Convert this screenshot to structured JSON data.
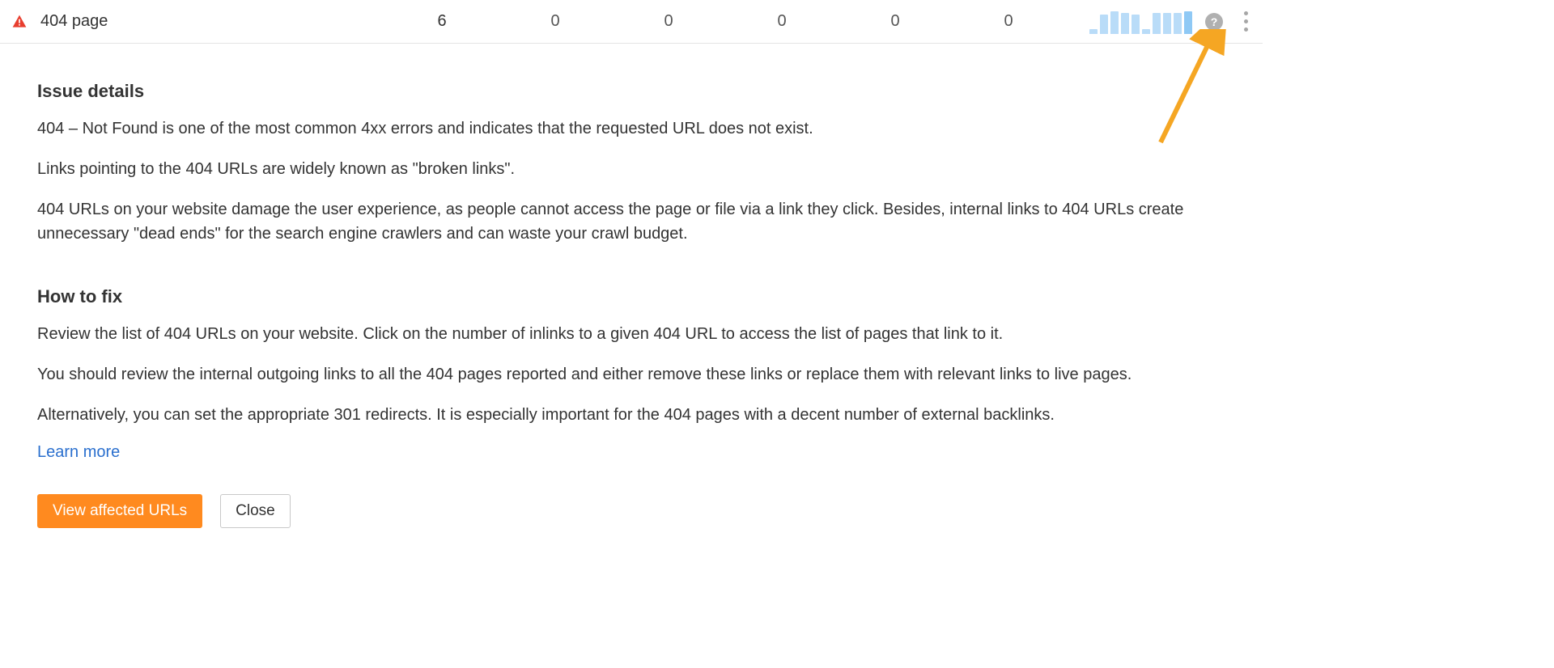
{
  "header": {
    "issue_name": "404 page",
    "counts": [
      "6",
      "0",
      "0",
      "0",
      "0",
      "0"
    ],
    "sparkline_heights": [
      6,
      24,
      28,
      26,
      24,
      6,
      26,
      26,
      26,
      28
    ],
    "help_symbol": "?"
  },
  "details": {
    "title": "Issue details",
    "paragraphs": [
      "404 – Not Found is one of the most common 4xx errors and indicates that the requested URL does not exist.",
      "Links pointing to the 404 URLs are widely known as \"broken links\".",
      "404 URLs on your website damage the user experience, as people cannot access the page or file via a link they click. Besides, internal links to 404 URLs create unnecessary \"dead ends\" for the search engine crawlers and can waste your crawl budget."
    ]
  },
  "fix": {
    "title": "How to fix",
    "paragraphs": [
      "Review the list of 404 URLs on your website. Click on the number of inlinks to a given 404 URL to access the list of pages that link to it.",
      "You should review the internal outgoing links to all the 404 pages reported and either remove these links or replace them with relevant links to live pages.",
      "Alternatively, you can set the appropriate 301 redirects. It is especially important for the 404 pages with a decent number of external backlinks."
    ]
  },
  "links": {
    "learn_more": "Learn more"
  },
  "buttons": {
    "view_affected": "View affected URLs",
    "close": "Close"
  }
}
